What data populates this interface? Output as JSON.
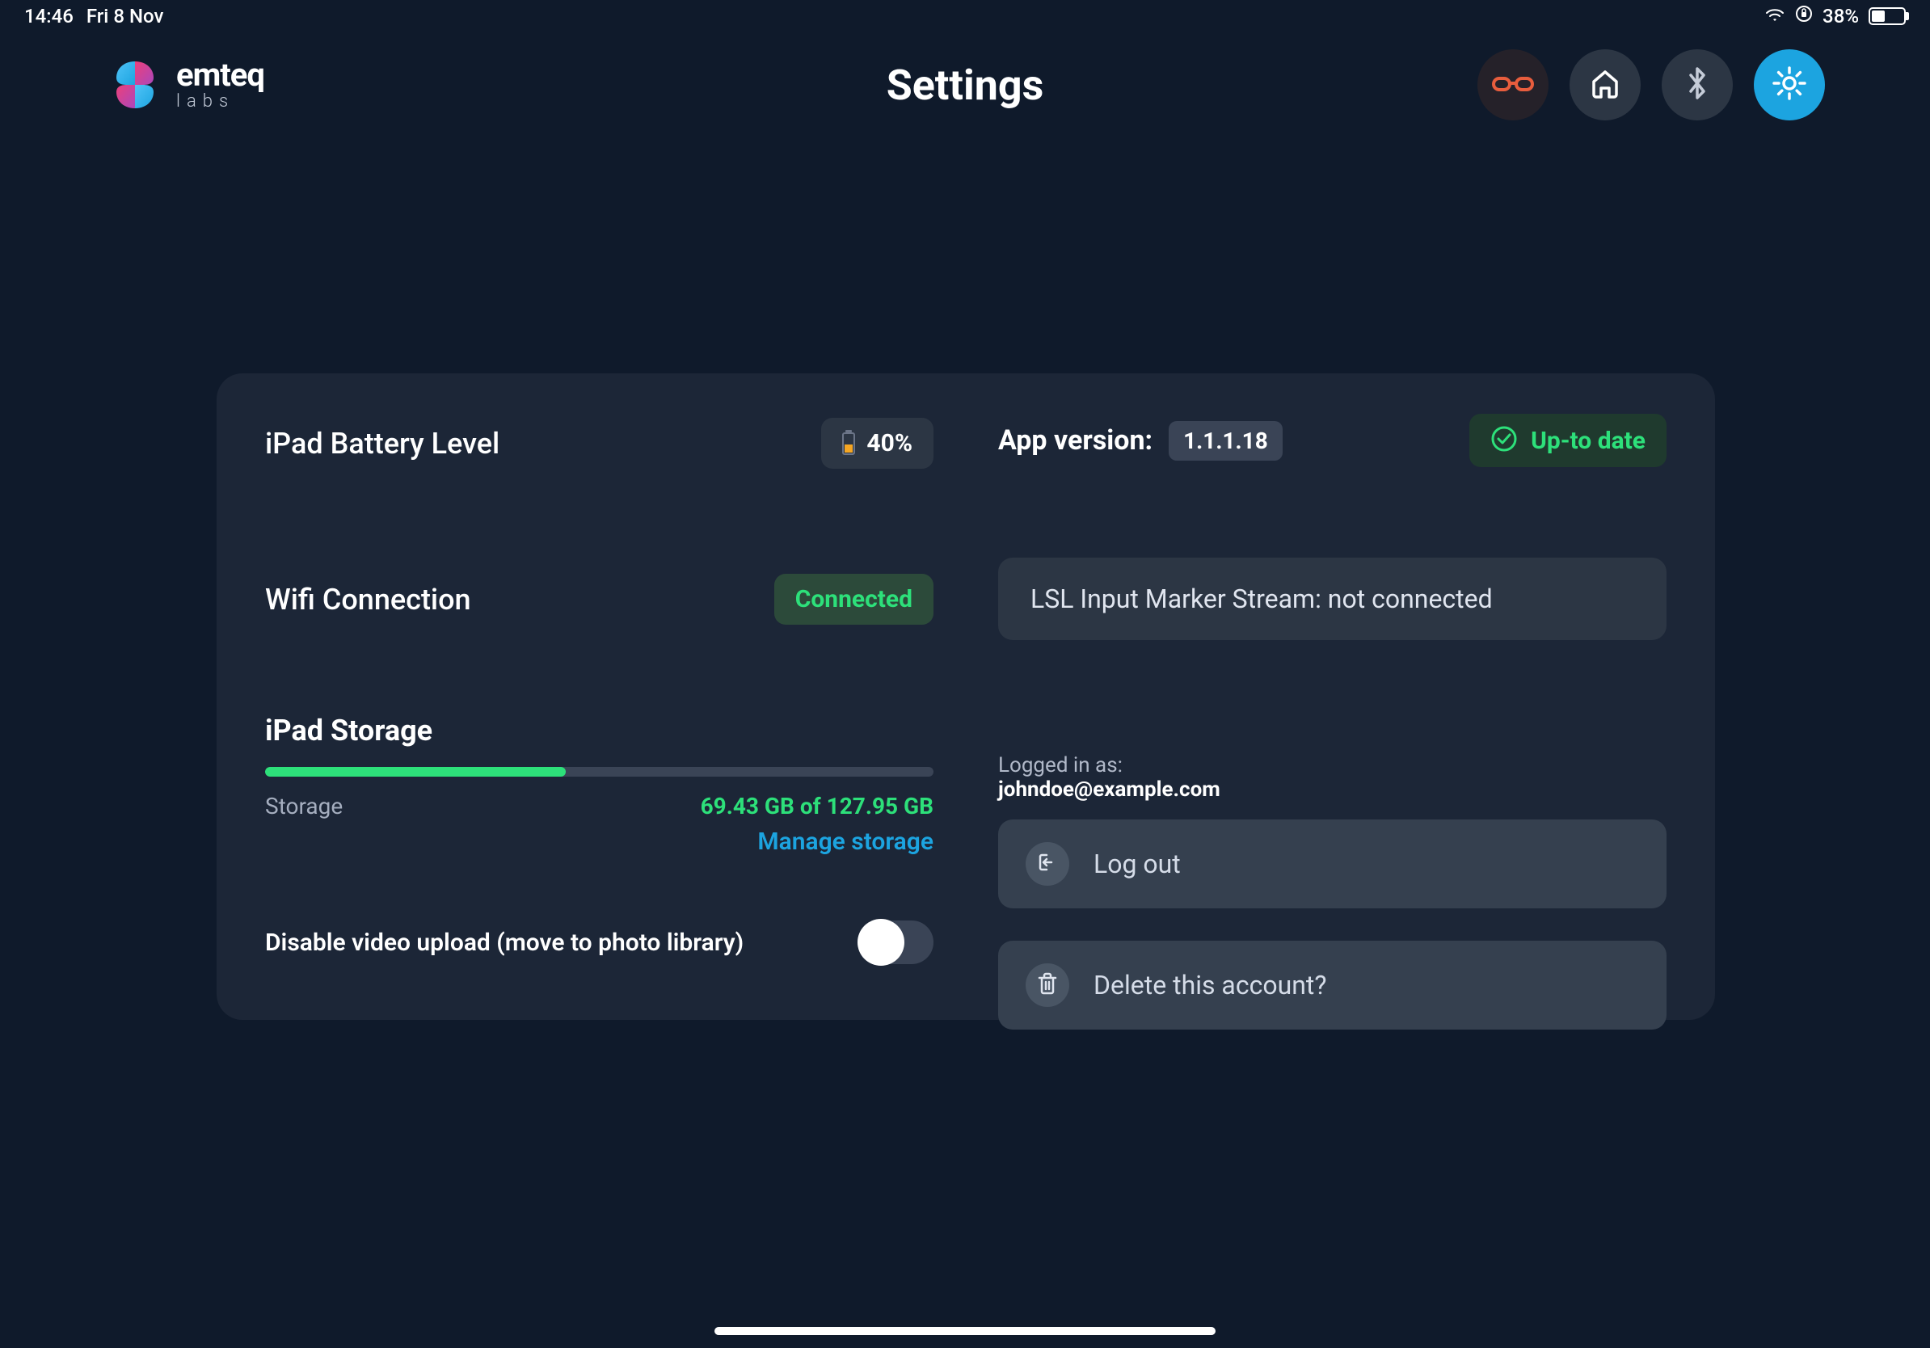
{
  "statusBar": {
    "time": "14:46",
    "date": "Fri 8 Nov",
    "batteryPercent": "38%",
    "batteryFillWidth": "38%"
  },
  "header": {
    "logo": {
      "main": "emteq",
      "sub": "labs"
    },
    "title": "Settings"
  },
  "battery": {
    "label": "iPad Battery Level",
    "value": "40%"
  },
  "wifi": {
    "label": "Wifi Connection",
    "status": "Connected"
  },
  "storage": {
    "title": "iPad Storage",
    "label": "Storage",
    "value": "69.43 GB of 127.95 GB",
    "percent": "45%",
    "manageLink": "Manage storage"
  },
  "videoToggle": {
    "label": "Disable video upload (move to photo library)"
  },
  "appVersion": {
    "label": "App version:",
    "value": "1.1.1.18",
    "status": "Up-to date"
  },
  "stream": {
    "text": "LSL Input Marker Stream: not connected"
  },
  "account": {
    "label": "Logged in as:",
    "email": "johndoe@example.com",
    "logout": "Log out",
    "delete": "Delete this account?"
  },
  "colors": {
    "accent": "#1ca4e0",
    "success": "#2de07a",
    "panel": "#1c2637",
    "background": "#0f1a2b"
  }
}
